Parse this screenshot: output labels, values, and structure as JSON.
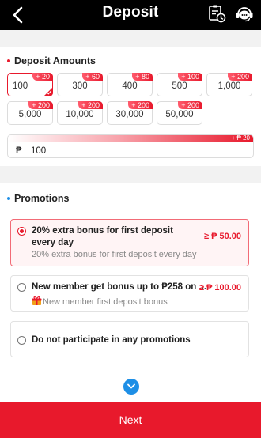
{
  "header": {
    "title": "Deposit"
  },
  "deposit_amounts": {
    "title": "Deposit Amounts",
    "options": [
      {
        "value": "100",
        "bonus": "+ 20",
        "selected": true
      },
      {
        "value": "300",
        "bonus": "+ 60",
        "selected": false
      },
      {
        "value": "400",
        "bonus": "+ 80",
        "selected": false
      },
      {
        "value": "500",
        "bonus": "+ 100",
        "selected": false
      },
      {
        "value": "1,000",
        "bonus": "+ 200",
        "selected": false
      },
      {
        "value": "5,000",
        "bonus": "+ 200",
        "selected": false
      },
      {
        "value": "10,000",
        "bonus": "+ 200",
        "selected": false
      },
      {
        "value": "30,000",
        "bonus": "+ 200",
        "selected": false
      },
      {
        "value": "50,000",
        "bonus": "+ 200",
        "selected": false
      }
    ],
    "input": {
      "currency_symbol": "₱",
      "value": "100",
      "bonus_label": "+ ₱ 20"
    }
  },
  "promotions": {
    "title": "Promotions",
    "items": [
      {
        "title": "20% extra bonus for first deposit every day",
        "subtitle": "20% extra bonus for first deposit every day",
        "min_amount": "≥ ₱ 50.00",
        "selected": true
      },
      {
        "title": "New member get bonus up to ₱258 on ...",
        "subtitle": "New member first deposit bonus",
        "min_amount": "≥ ₱ 100.00",
        "selected": false
      },
      {
        "title": "Do not participate in any promotions",
        "subtitle": "",
        "min_amount": "",
        "selected": false
      }
    ]
  },
  "footer": {
    "next_label": "Next"
  },
  "colors": {
    "header_bg": "#000000",
    "accent": "#e8192c",
    "section_dot_amounts": "#e8192c",
    "section_dot_promotions": "#1e8fe6",
    "scroll_button": "#1e8fe6"
  },
  "icons": {
    "back": "back-arrow-icon",
    "records": "deposit-records-icon",
    "support": "customer-service-icon",
    "gift": "gift-icon",
    "scroll": "chevron-down-icon"
  }
}
